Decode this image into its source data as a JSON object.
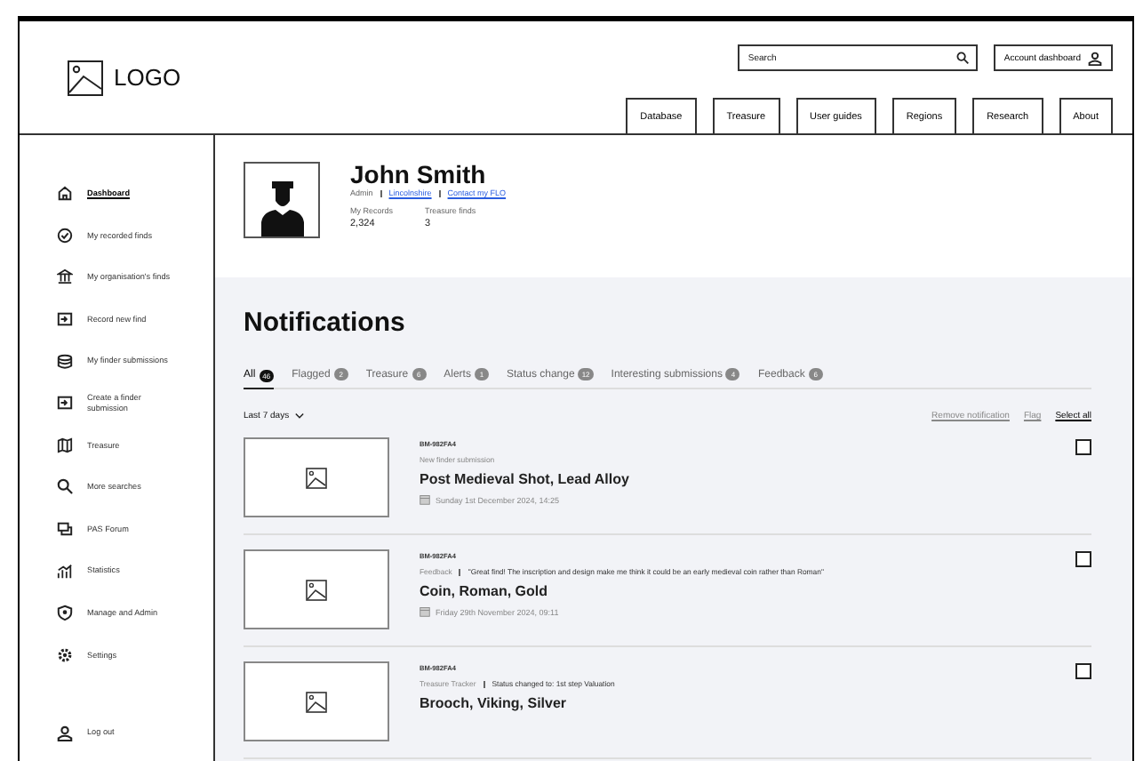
{
  "header": {
    "logo": "LOGO",
    "search": {
      "placeholder": "Search"
    },
    "account_button": "Account dashboard",
    "nav": [
      "Database",
      "Treasure",
      "User guides",
      "Regions",
      "Research",
      "About"
    ]
  },
  "sidebar": {
    "items": [
      {
        "label": "Dashboard",
        "selected": true
      },
      {
        "label": "My recorded finds",
        "selected": false
      },
      {
        "label": "My organisation's finds",
        "selected": false
      },
      {
        "label": "Record new find",
        "selected": false
      },
      {
        "label": "My finder submissions",
        "selected": false
      },
      {
        "label": "Create a finder submission",
        "selected": false
      },
      {
        "label": "Treasure",
        "selected": false
      },
      {
        "label": "More searches",
        "selected": false
      },
      {
        "label": "PAS Forum",
        "selected": false
      },
      {
        "label": "Statistics",
        "selected": false
      },
      {
        "label": "Manage and Admin",
        "selected": false
      },
      {
        "label": "Settings",
        "selected": false
      }
    ],
    "logout": "Log out"
  },
  "profile": {
    "name": "John Smith",
    "role": "Admin",
    "links": [
      "Lincolnshire",
      "Contact my FLO"
    ],
    "stats": [
      {
        "label": "My Records",
        "value": "2,324"
      },
      {
        "label": "Treasure finds",
        "value": "3"
      }
    ]
  },
  "notifications": {
    "title": "Notifications",
    "tabs": [
      {
        "label": "All",
        "count": "46",
        "selected": true
      },
      {
        "label": "Flagged",
        "count": "2",
        "selected": false
      },
      {
        "label": "Treasure",
        "count": "6",
        "selected": false
      },
      {
        "label": "Alerts",
        "count": "1",
        "selected": false
      },
      {
        "label": "Status change",
        "count": "12",
        "selected": false
      },
      {
        "label": "Interesting submissions",
        "count": "4",
        "selected": false
      },
      {
        "label": "Feedback",
        "count": "6",
        "selected": false
      }
    ],
    "filter": "Last 7 days",
    "actions": [
      {
        "label": "Remove notification",
        "disabled": true
      },
      {
        "label": "Flag",
        "disabled": true
      },
      {
        "label": "Select all",
        "disabled": false
      }
    ],
    "items": [
      {
        "code": "BM-982FA4",
        "type": "New finder submission",
        "title": "Post Medieval Shot, Lead Alloy",
        "date": "Sunday 1st December 2024, 14:25",
        "checked": false
      },
      {
        "code": "BM-982FA4",
        "type": "Feedback",
        "message": "\"Great find! The inscription and design make me think it could be an early medieval coin rather than Roman\"",
        "title": "Coin, Roman, Gold",
        "date": "Friday 29th November 2024, 09:11",
        "checked": false
      },
      {
        "code": "BM-982FA4",
        "type": "Treasure Tracker",
        "message": "Status changed to: 1st step Valuation",
        "title": "Brooch, Viking, Silver",
        "checked": false
      }
    ]
  }
}
